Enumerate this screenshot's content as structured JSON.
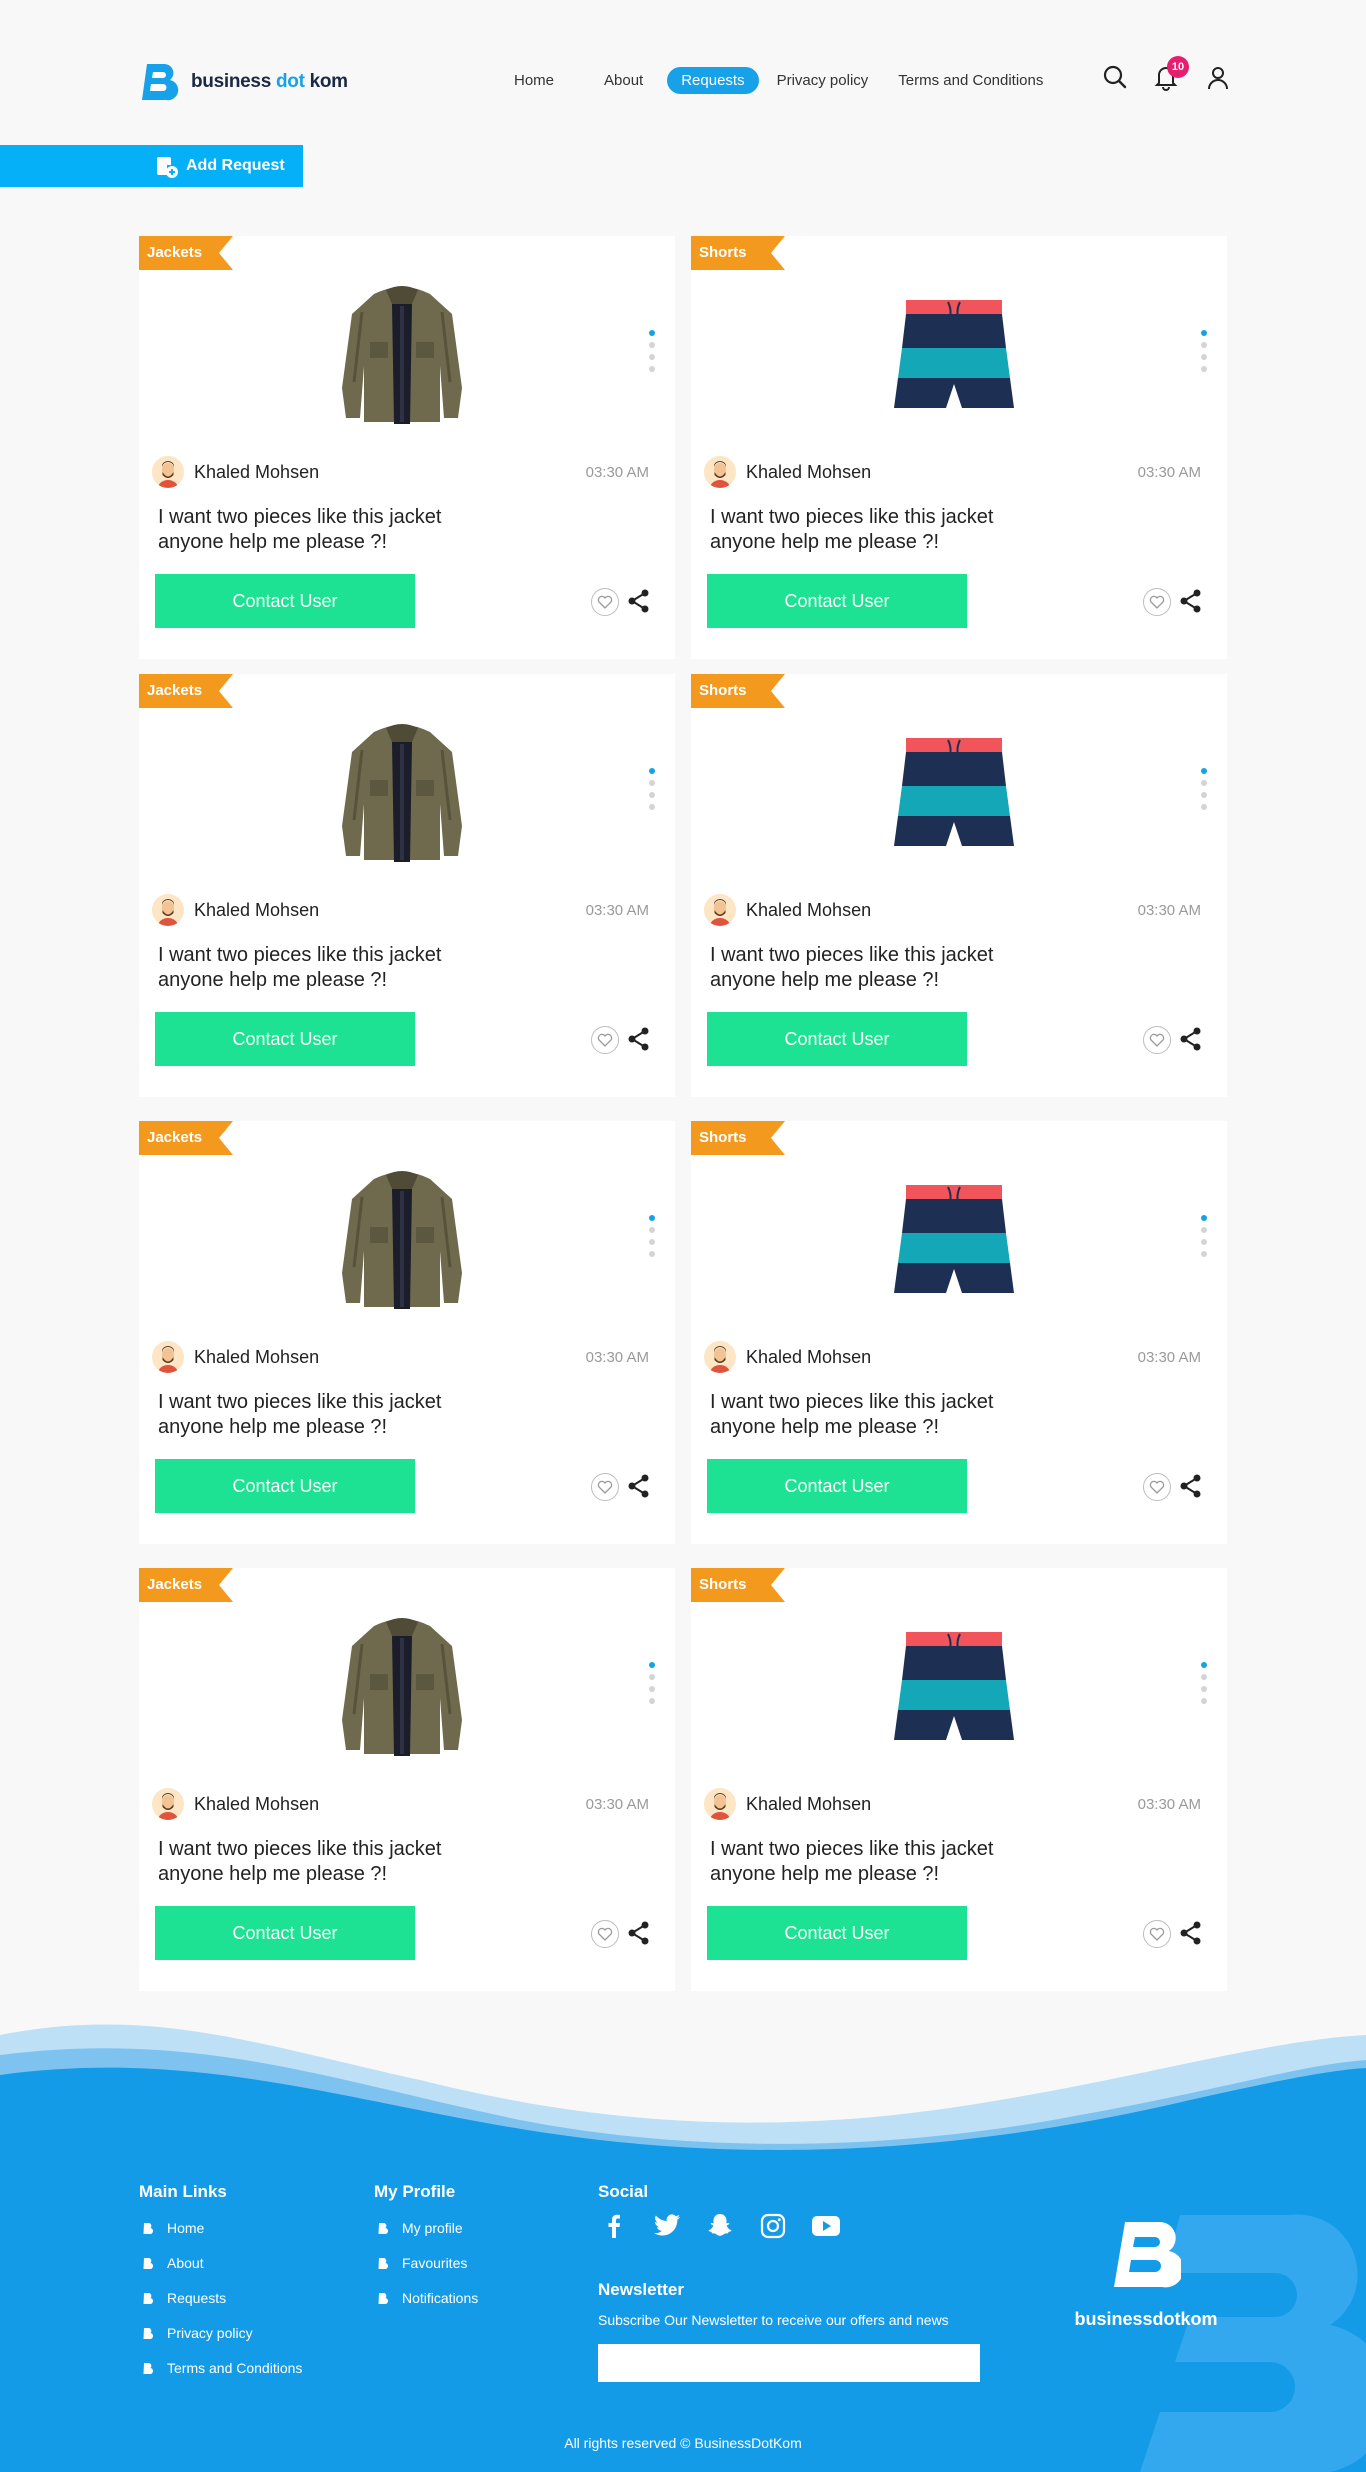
{
  "header": {
    "logo": {
      "part1": "business",
      "part2": "dot",
      "part3": "kom"
    },
    "nav": [
      {
        "label": "Home",
        "active": false
      },
      {
        "label": "About",
        "active": false
      },
      {
        "label": "Requests",
        "active": true
      },
      {
        "label": "Privacy policy",
        "active": false
      },
      {
        "label": "Terms and Conditions",
        "active": false
      }
    ],
    "icons": [
      "search-icon",
      "bell-icon",
      "user-icon"
    ],
    "notification_count": "10"
  },
  "add_request_label": "Add Request",
  "cards": [
    {
      "category": "Jackets",
      "product": "jacket",
      "user": "Khaled Mohsen",
      "time": "03:30 AM",
      "message": "I want two pieces like this jacket anyone help me please ?!",
      "button": "Contact User"
    },
    {
      "category": "Shorts",
      "product": "shorts",
      "user": "Khaled Mohsen",
      "time": "03:30 AM",
      "message": "I want two pieces like this jacket anyone help me please ?!",
      "button": "Contact User"
    },
    {
      "category": "Jackets",
      "product": "jacket",
      "user": "Khaled Mohsen",
      "time": "03:30 AM",
      "message": "I want two pieces like this jacket anyone help me please ?!",
      "button": "Contact User"
    },
    {
      "category": "Shorts",
      "product": "shorts",
      "user": "Khaled Mohsen",
      "time": "03:30 AM",
      "message": "I want two pieces like this jacket anyone help me please ?!",
      "button": "Contact User"
    },
    {
      "category": "Jackets",
      "product": "jacket",
      "user": "Khaled Mohsen",
      "time": "03:30 AM",
      "message": "I want two pieces like this jacket anyone help me please ?!",
      "button": "Contact User"
    },
    {
      "category": "Shorts",
      "product": "shorts",
      "user": "Khaled Mohsen",
      "time": "03:30 AM",
      "message": "I want two pieces like this jacket anyone help me please ?!",
      "button": "Contact User"
    },
    {
      "category": "Jackets",
      "product": "jacket",
      "user": "Khaled Mohsen",
      "time": "03:30 AM",
      "message": "I want two pieces like this jacket anyone help me please ?!",
      "button": "Contact User"
    },
    {
      "category": "Shorts",
      "product": "shorts",
      "user": "Khaled Mohsen",
      "time": "03:30 AM",
      "message": "I want two pieces like this jacket anyone help me please ?!",
      "button": "Contact User"
    }
  ],
  "footer": {
    "main_links": {
      "title": "Main Links",
      "items": [
        "Home",
        "About",
        "Requests",
        "Privacy policy",
        "Terms and Conditions"
      ]
    },
    "my_profile": {
      "title": "My Profile",
      "items": [
        "My profile",
        "Favourites",
        "Notifications"
      ]
    },
    "social": {
      "title": "Social",
      "icons": [
        "facebook-icon",
        "twitter-icon",
        "snapchat-icon",
        "instagram-icon",
        "youtube-icon"
      ]
    },
    "newsletter": {
      "title": "Newsletter",
      "subtitle": "Subscribe Our Newsletter to receive our offers and news",
      "placeholder": ""
    },
    "logo_text": "businessdotkom",
    "copyright": "All rights reserved © BusinessDotKom"
  },
  "colors": {
    "brand": "#16a1e8",
    "button": "#1de293",
    "tag": "#f39a1e",
    "badge": "#e61e6e",
    "footer": "#149be8"
  }
}
